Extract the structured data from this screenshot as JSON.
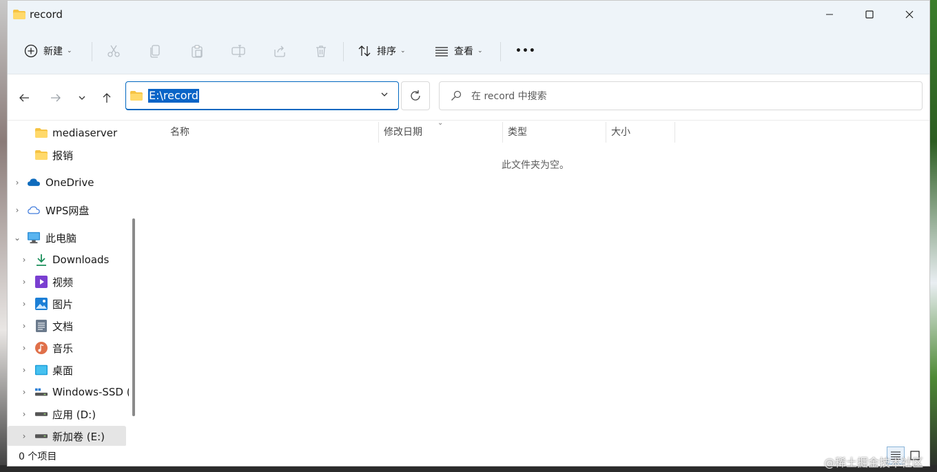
{
  "window": {
    "title": "record",
    "controls": {
      "minimize": "—",
      "maximize": "☐",
      "close": "✕"
    }
  },
  "toolbar": {
    "new_label": "新建",
    "sort_label": "排序",
    "view_label": "查看",
    "more_label": "•••"
  },
  "address": {
    "path": "E:\\record",
    "search_placeholder": "在 record 中搜索"
  },
  "sidebar": {
    "items": [
      {
        "label": "mediaserver"
      },
      {
        "label": "报销"
      },
      {
        "label": "OneDrive"
      },
      {
        "label": "WPS网盘"
      },
      {
        "label": "此电脑"
      },
      {
        "label": "Downloads"
      },
      {
        "label": "视频"
      },
      {
        "label": "图片"
      },
      {
        "label": "文档"
      },
      {
        "label": "音乐"
      },
      {
        "label": "桌面"
      },
      {
        "label": "Windows-SSD ("
      },
      {
        "label": "应用 (D:)"
      },
      {
        "label": "新加卷 (E:)"
      }
    ]
  },
  "columns": {
    "name": "名称",
    "modified": "修改日期",
    "type": "类型",
    "size": "大小"
  },
  "empty_message": "此文件夹为空。",
  "status": {
    "item_count": "0 个项目"
  },
  "watermark": "@稀土掘金技术社区",
  "colors": {
    "accent": "#0067c0",
    "titlebar_bg": "#eef4f9",
    "selection": "#0a64c7",
    "folder": "#f6c343"
  }
}
